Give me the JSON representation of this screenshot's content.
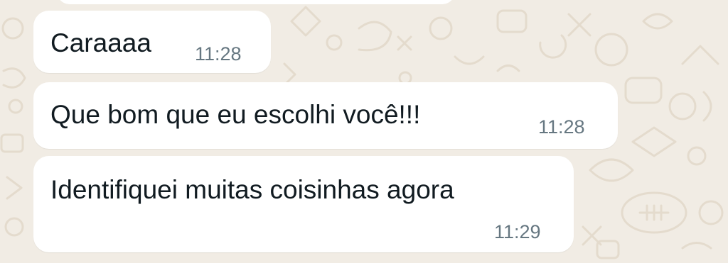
{
  "chat": {
    "messages": [
      {
        "text": "Caraaaa",
        "time": "11:28"
      },
      {
        "text": "Que bom que eu escolhi você!!!",
        "time": "11:28"
      },
      {
        "text": "Identifiquei muitas coisinhas agora",
        "time": "11:29"
      }
    ]
  },
  "colors": {
    "background": "#f1ece4",
    "bubble": "#ffffff",
    "message_text": "#111b21",
    "timestamp": "#667781"
  }
}
